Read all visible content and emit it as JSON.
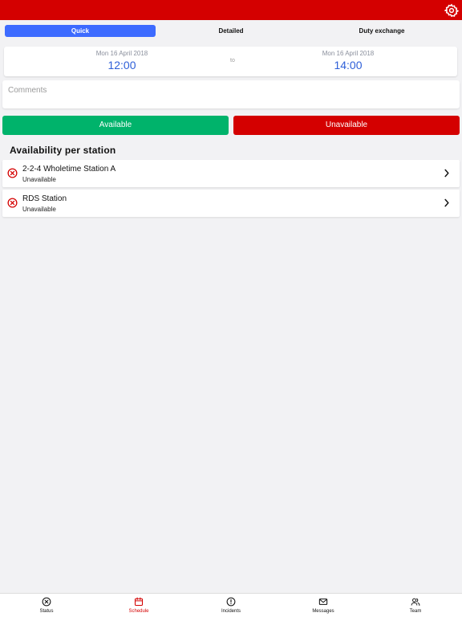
{
  "colors": {
    "brand_red": "#d40000",
    "accent_blue": "#3d6bff",
    "available_green": "#00b36b",
    "time_blue": "#2e5fd8"
  },
  "tabs": [
    {
      "label": "Quick",
      "active": true
    },
    {
      "label": "Detailed",
      "active": false
    },
    {
      "label": "Duty exchange",
      "active": false
    }
  ],
  "range": {
    "from": {
      "date": "Mon 16 April 2018",
      "time": "12:00"
    },
    "separator": "to",
    "to": {
      "date": "Mon 16 April 2018",
      "time": "14:00"
    }
  },
  "comments": {
    "placeholder": "Comments"
  },
  "actions": {
    "available_label": "Available",
    "unavailable_label": "Unavailable"
  },
  "availability": {
    "title": "Availability per station",
    "stations": [
      {
        "name": "2-2-4 Wholetime Station A",
        "status": "Unavailable",
        "icon": "unavailable-x-icon"
      },
      {
        "name": "RDS Station",
        "status": "Unavailable",
        "icon": "unavailable-x-icon"
      }
    ]
  },
  "nav": [
    {
      "label": "Status",
      "icon": "status-icon",
      "active": false
    },
    {
      "label": "Schedule",
      "icon": "calendar-icon",
      "active": true
    },
    {
      "label": "Incidents",
      "icon": "alert-icon",
      "active": false
    },
    {
      "label": "Messages",
      "icon": "envelope-icon",
      "active": false
    },
    {
      "label": "Team",
      "icon": "team-icon",
      "active": false
    }
  ]
}
